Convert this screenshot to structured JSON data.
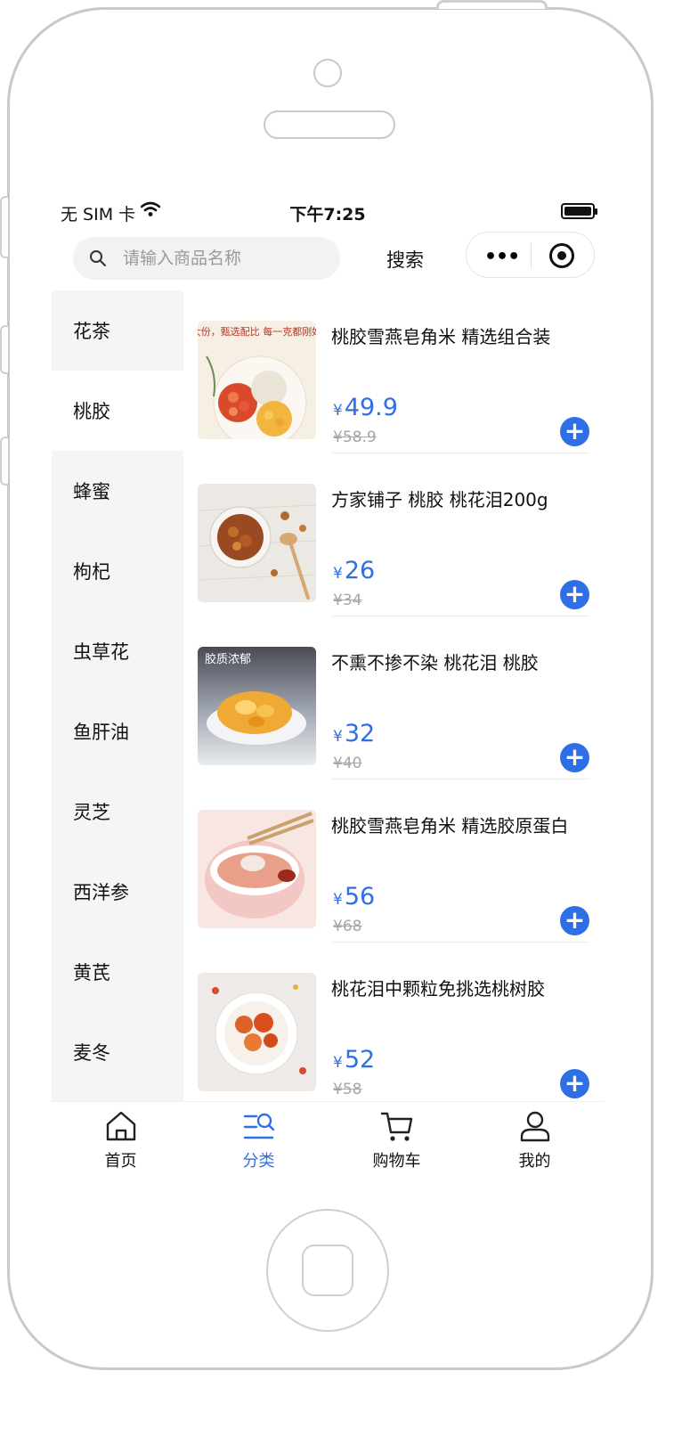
{
  "status_bar": {
    "carrier": "无 SIM 卡",
    "time": "下午7:25"
  },
  "search": {
    "placeholder": "请输入商品名称",
    "button_label": "搜索"
  },
  "capsule": {
    "more_icon": "more-dots-icon",
    "close_icon": "target-circle-icon"
  },
  "categories": [
    {
      "label": "花茶"
    },
    {
      "label": "桃胶",
      "active": true
    },
    {
      "label": "蜂蜜"
    },
    {
      "label": "枸杞"
    },
    {
      "label": "虫草花"
    },
    {
      "label": "鱼肝油"
    },
    {
      "label": "灵芝"
    },
    {
      "label": "西洋参"
    },
    {
      "label": "黄芪"
    },
    {
      "label": "麦冬"
    }
  ],
  "products": [
    {
      "title": "桃胶雪燕皂角米 精选组合装",
      "currency": "¥",
      "price": "49.9",
      "original_price": "¥58.9",
      "thumb_caption": "大份，甄选配比 每一克都刚好"
    },
    {
      "title": "方家铺子 桃胶 桃花泪200g",
      "currency": "¥",
      "price": "26",
      "original_price": "¥34",
      "thumb_caption": ""
    },
    {
      "title": "不熏不掺不染 桃花泪 桃胶",
      "currency": "¥",
      "price": "32",
      "original_price": "¥40",
      "thumb_caption": "胶质浓郁"
    },
    {
      "title": "桃胶雪燕皂角米 精选胶原蛋白",
      "currency": "¥",
      "price": "56",
      "original_price": "¥68",
      "thumb_caption": ""
    },
    {
      "title": "桃花泪中颗粒免挑选桃树胶",
      "currency": "¥",
      "price": "52",
      "original_price": "¥58",
      "thumb_caption": ""
    }
  ],
  "tabbar": [
    {
      "label": "首页",
      "icon": "home-icon"
    },
    {
      "label": "分类",
      "icon": "category-search-icon",
      "active": true
    },
    {
      "label": "购物车",
      "icon": "cart-icon"
    },
    {
      "label": "我的",
      "icon": "user-icon"
    }
  ],
  "colors": {
    "accent": "#2f6fe5",
    "sidebar_bg": "#f5f5f5",
    "muted_text": "#a5a5a5"
  }
}
